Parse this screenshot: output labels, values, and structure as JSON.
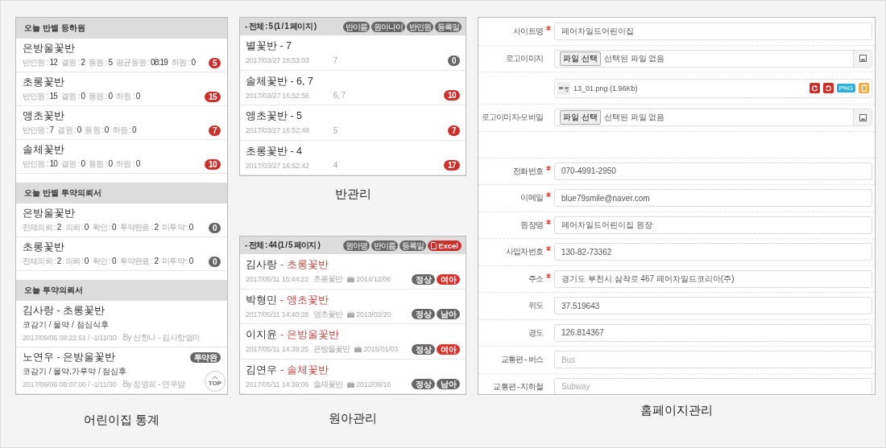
{
  "stats_panel": {
    "caption": "어린이집 통계",
    "top_button": "TOP",
    "sections": [
      {
        "title": "오늘 반별 등하원",
        "kind": "class",
        "items": [
          {
            "name": "은방울꽃반",
            "stats": [
              {
                "label": "반인원 :",
                "value": "12"
              },
              {
                "label": "결원 :",
                "value": "2"
              },
              {
                "label": "등원 :",
                "value": "5"
              },
              {
                "label": "평균등원 :",
                "value": "08:19"
              },
              {
                "label": "하원 :",
                "value": "0"
              }
            ],
            "badge": "5",
            "color": "#c9302c"
          },
          {
            "name": "초롱꽃반",
            "stats": [
              {
                "label": "반인원 :",
                "value": "15"
              },
              {
                "label": "결원 :",
                "value": "0"
              },
              {
                "label": "등원 :",
                "value": "0"
              },
              {
                "label": "하원 :",
                "value": "0"
              }
            ],
            "badge": "15",
            "color": "#c9302c"
          },
          {
            "name": "앵초꽃반",
            "stats": [
              {
                "label": "반인원 :",
                "value": "7"
              },
              {
                "label": "결원 :",
                "value": "0"
              },
              {
                "label": "등원 :",
                "value": "0"
              },
              {
                "label": "하원 :",
                "value": "0"
              }
            ],
            "badge": "7",
            "color": "#c9302c"
          },
          {
            "name": "솔체꽃반",
            "stats": [
              {
                "label": "반인원 :",
                "value": "10"
              },
              {
                "label": "결원 :",
                "value": "0"
              },
              {
                "label": "등원 :",
                "value": "0"
              },
              {
                "label": "하원 :",
                "value": "0"
              }
            ],
            "badge": "10",
            "color": "#c9302c"
          }
        ]
      },
      {
        "title": "오늘 반별 투약의뢰서",
        "kind": "class",
        "items": [
          {
            "name": "은방울꽃반",
            "stats": [
              {
                "label": "전체의뢰 :",
                "value": "2"
              },
              {
                "label": "의뢰 :",
                "value": "0"
              },
              {
                "label": "확인 :",
                "value": "0"
              },
              {
                "label": "투약완료 :",
                "value": "2"
              },
              {
                "label": "미투약 :",
                "value": "0"
              }
            ],
            "badge": "0",
            "color": "#666666"
          },
          {
            "name": "초롱꽃반",
            "stats": [
              {
                "label": "전체의뢰 :",
                "value": "2"
              },
              {
                "label": "의뢰 :",
                "value": "0"
              },
              {
                "label": "확인 :",
                "value": "0"
              },
              {
                "label": "투약완료 :",
                "value": "2"
              },
              {
                "label": "미투약 :",
                "value": "0"
              }
            ],
            "badge": "0",
            "color": "#666666"
          }
        ]
      },
      {
        "title": "오늘 투약의뢰서",
        "kind": "request",
        "items": [
          {
            "title": "김사랑 - 초롱꽃반",
            "detail": "코감기 / 물약 / 점심식후",
            "time": "2017/09/06 08:22:51 / -1/11/30",
            "by": "By 신한나 - 김사랑엄마"
          },
          {
            "title": "노연우 - 은방울꽃반",
            "detail": "코감기 / 물약,가루약 / 점심후",
            "time": "2017/09/06 08:07:00 / -1/11/30",
            "by": "By 정명희 - 연우맘",
            "badge": "투약완",
            "color": "#666666"
          }
        ]
      }
    ]
  },
  "class_panel": {
    "caption": "반관리",
    "summary": "- 전체 : 5 (1 / 1 페이지 )",
    "sort_buttons": [
      "반이름",
      "원아나이",
      "반인원",
      "등록일"
    ],
    "rows": [
      {
        "title": "별꽃반 - 7",
        "time": "2017/03/27 16:53:03",
        "ages": "7",
        "badge": "0",
        "color": "#666666"
      },
      {
        "title": "솔체꽃반 - 6, 7",
        "time": "2017/03/27 16:52:56",
        "ages": "6, 7",
        "badge": "10",
        "color": "#c9302c"
      },
      {
        "title": "앵초꽃반 - 5",
        "time": "2017/03/27 16:52:48",
        "ages": "5",
        "badge": "7",
        "color": "#c9302c"
      },
      {
        "title": "초롱꽃반 - 4",
        "time": "2017/03/27 16:52:42",
        "ages": "4",
        "badge": "17",
        "color": "#c9302c"
      }
    ]
  },
  "child_panel": {
    "caption": "원아관리",
    "summary": "- 전체 : 44 (1 / 5 페이지 )",
    "sort_buttons": [
      "원아명",
      "반이름",
      "등록일"
    ],
    "excel_button": "Excel",
    "rows": [
      {
        "name": "김사랑",
        "class": "- 초롱꽃반",
        "time": "2017/05/11 15:44:22",
        "class_label": "초롱꽃반",
        "birth": "2014/12/06",
        "status": "정상",
        "gender": "여아",
        "color": "#d9332e"
      },
      {
        "name": "박형민",
        "class": "- 앵초꽃반",
        "time": "2017/05/11 14:40:28",
        "class_label": "앵초꽃반",
        "birth": "2013/02/20",
        "status": "정상",
        "gender": "남아",
        "color": "#666666"
      },
      {
        "name": "이지윤",
        "class": "- 은방울꽃반",
        "time": "2017/05/11 14:39:25",
        "class_label": "은방울꽃반",
        "birth": "2015/01/03",
        "status": "정상",
        "gender": "여아",
        "color": "#d9332e"
      },
      {
        "name": "김연우",
        "class": "- 솔체꽃반",
        "time": "2017/05/11 14:39:06",
        "class_label": "솔체꽃반",
        "birth": "2012/08/16",
        "status": "정상",
        "gender": "남아",
        "color": "#666666"
      }
    ]
  },
  "homepage_panel": {
    "caption": "홈페이지관리",
    "fields": [
      {
        "kind": "text",
        "label": "사이트명",
        "required": true,
        "value": "페어차일드어린이집"
      },
      {
        "kind": "file",
        "label": "로고이미지",
        "required": false,
        "button": "파일 선택",
        "text": "선택된 파일 없음"
      },
      {
        "kind": "preview",
        "file": "13_01.png (1.96Kb)",
        "format": "PNG"
      },
      {
        "kind": "file",
        "label": "로고이미지-모바일",
        "required": false,
        "button": "파일 선택",
        "text": "선택된 파일 없음"
      },
      {
        "kind": "spacer"
      },
      {
        "kind": "text",
        "label": "전화번호",
        "required": true,
        "value": "070-4991-2950"
      },
      {
        "kind": "text",
        "label": "이메일",
        "required": true,
        "value": "blue79smile@naver.com"
      },
      {
        "kind": "text",
        "label": "원장명",
        "required": true,
        "value": "페어차일드어린이집 원장"
      },
      {
        "kind": "text",
        "label": "사업자번호",
        "required": true,
        "value": "130-82-73362"
      },
      {
        "kind": "text",
        "label": "주소",
        "required": true,
        "value": "경기도 부천시 삼작로 467 페어차일드코리아(주)"
      },
      {
        "kind": "text",
        "label": "위도",
        "required": false,
        "value": "37.519643"
      },
      {
        "kind": "text",
        "label": "경도",
        "required": false,
        "value": "126.814367"
      },
      {
        "kind": "text",
        "label": "교통편 - 버스",
        "required": false,
        "placeholder": "Bus"
      },
      {
        "kind": "text",
        "label": "교통편 - 지하철",
        "required": false,
        "placeholder": "Subway"
      }
    ]
  }
}
